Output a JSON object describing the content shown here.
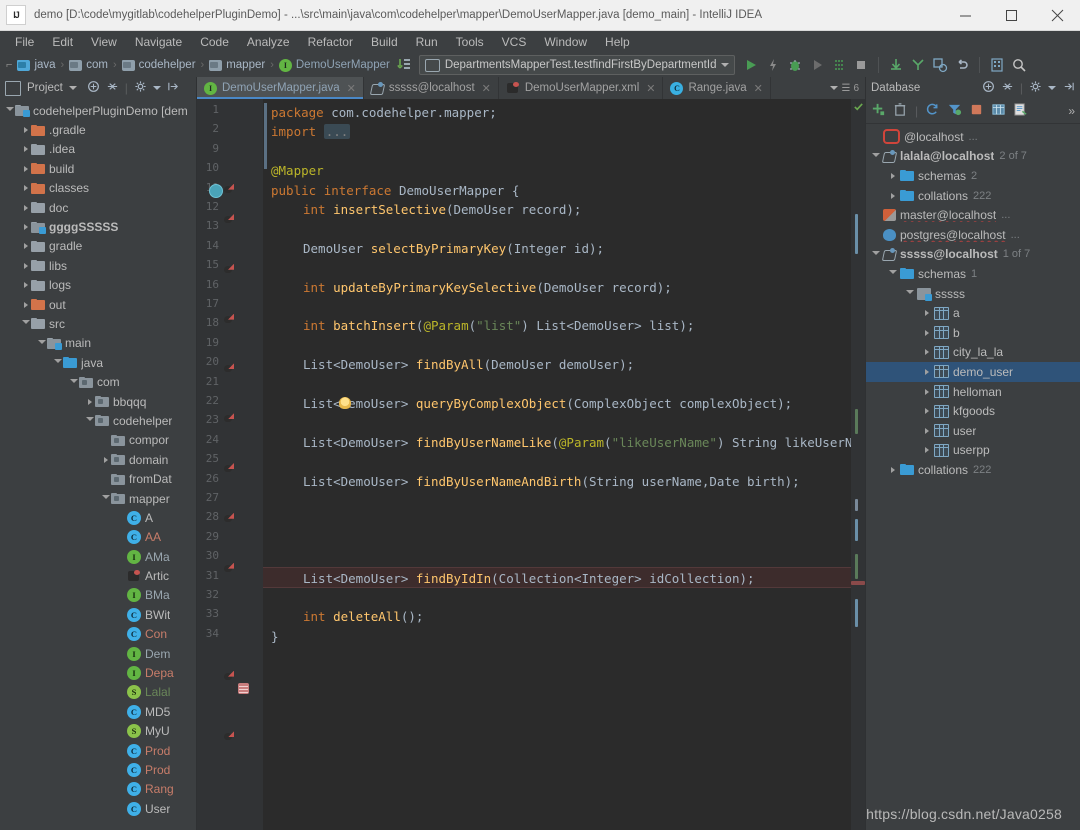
{
  "window": {
    "title": "demo [D:\\code\\mygitlab\\codehelperPluginDemo] - ...\\src\\main\\java\\com\\codehelper\\mapper\\DemoUserMapper.java [demo_main] - IntelliJ IDEA",
    "logo": "IJ",
    "minimize": "minimize-icon",
    "maximize": "maximize-icon",
    "close": "close-icon"
  },
  "menubar": {
    "items": [
      "File",
      "Edit",
      "View",
      "Navigate",
      "Code",
      "Analyze",
      "Refactor",
      "Build",
      "Run",
      "Tools",
      "VCS",
      "Window",
      "Help"
    ]
  },
  "navbar": {
    "crumbs": [
      {
        "label": "java",
        "icon": "source-folder-icon"
      },
      {
        "label": "com",
        "icon": "package-folder-icon"
      },
      {
        "label": "codehelper",
        "icon": "package-folder-icon"
      },
      {
        "label": "mapper",
        "icon": "package-folder-icon"
      },
      {
        "label": "DemoUserMapper",
        "icon": "interface-icon"
      }
    ],
    "run_config": "DepartmentsMapperTest.testfindFirstByDepartmentId",
    "toolbar_icons": [
      "run-icon",
      "run-with-coverage-icon",
      "debug-icon",
      "profile-icon",
      "run-dirty-icon",
      "stop-icon",
      "update-project-icon",
      "commit-icon",
      "branch-icon",
      "undo-icon",
      "settings-icon",
      "search-everywhere-icon"
    ]
  },
  "project_panel": {
    "title": "Project",
    "head_icons": [
      "collapse-scope-icon",
      "expand-collapse-icon",
      "gear-icon",
      "hide-icon"
    ],
    "tree": [
      {
        "depth": 0,
        "label": "codehelperPluginDemo [dem",
        "arrow": "open",
        "icon": "module-folder",
        "style": "white"
      },
      {
        "depth": 1,
        "label": ".gradle",
        "arrow": "closed",
        "icon": "folder-orange",
        "style": "white"
      },
      {
        "depth": 1,
        "label": ".idea",
        "arrow": "closed",
        "icon": "folder",
        "style": "white"
      },
      {
        "depth": 1,
        "label": "build",
        "arrow": "closed",
        "icon": "folder-orange",
        "style": "white"
      },
      {
        "depth": 1,
        "label": "classes",
        "arrow": "closed",
        "icon": "folder-orange",
        "style": "white"
      },
      {
        "depth": 1,
        "label": "doc",
        "arrow": "closed",
        "icon": "folder",
        "style": "white"
      },
      {
        "depth": 1,
        "label": "ggggSSSSS",
        "arrow": "closed",
        "icon": "module-folder",
        "style": "bold"
      },
      {
        "depth": 1,
        "label": "gradle",
        "arrow": "closed",
        "icon": "folder",
        "style": "white"
      },
      {
        "depth": 1,
        "label": "libs",
        "arrow": "closed",
        "icon": "folder",
        "style": "white"
      },
      {
        "depth": 1,
        "label": "logs",
        "arrow": "closed",
        "icon": "folder",
        "style": "white"
      },
      {
        "depth": 1,
        "label": "out",
        "arrow": "closed",
        "icon": "folder-orange",
        "style": "white"
      },
      {
        "depth": 1,
        "label": "src",
        "arrow": "open",
        "icon": "folder",
        "style": "white"
      },
      {
        "depth": 2,
        "label": "main",
        "arrow": "open",
        "icon": "module-folder",
        "style": "white"
      },
      {
        "depth": 3,
        "label": "java",
        "arrow": "open",
        "icon": "source-folder",
        "style": "white"
      },
      {
        "depth": 4,
        "label": "com",
        "arrow": "open",
        "icon": "package-folder",
        "style": "white"
      },
      {
        "depth": 5,
        "label": "bbqqq",
        "arrow": "closed",
        "icon": "package-folder",
        "style": "white"
      },
      {
        "depth": 5,
        "label": "codehelper",
        "arrow": "open",
        "icon": "package-folder",
        "style": "white"
      },
      {
        "depth": 6,
        "label": "compor",
        "arrow": "none",
        "icon": "package-folder",
        "style": "white"
      },
      {
        "depth": 6,
        "label": "domain",
        "arrow": "closed",
        "icon": "package-folder",
        "style": "white"
      },
      {
        "depth": 6,
        "label": "fromDat",
        "arrow": "none",
        "icon": "package-folder",
        "style": "white"
      },
      {
        "depth": 6,
        "label": "mapper",
        "arrow": "open",
        "icon": "package-folder",
        "style": "white"
      },
      {
        "depth": 7,
        "label": "A",
        "arrow": "none",
        "icon": "class-file",
        "style": "white"
      },
      {
        "depth": 7,
        "label": "AA",
        "arrow": "none",
        "icon": "class-file",
        "style": "red"
      },
      {
        "depth": 7,
        "label": "AMa",
        "arrow": "none",
        "icon": "interface-file",
        "style": "blue"
      },
      {
        "depth": 7,
        "label": "Artic",
        "arrow": "none",
        "icon": "xml-file",
        "style": "white"
      },
      {
        "depth": 7,
        "label": "BMa",
        "arrow": "none",
        "icon": "interface-file",
        "style": "blue"
      },
      {
        "depth": 7,
        "label": "BWit",
        "arrow": "none",
        "icon": "class-file",
        "style": "white"
      },
      {
        "depth": 7,
        "label": "Con",
        "arrow": "none",
        "icon": "class-file",
        "style": "red"
      },
      {
        "depth": 7,
        "label": "Dem",
        "arrow": "none",
        "icon": "interface-file",
        "style": "blue"
      },
      {
        "depth": 7,
        "label": "Depa",
        "arrow": "none",
        "icon": "interface-file",
        "style": "red"
      },
      {
        "depth": 7,
        "label": "Lalal",
        "arrow": "none",
        "icon": "scala-file",
        "style": "green"
      },
      {
        "depth": 7,
        "label": "MD5",
        "arrow": "none",
        "icon": "class-file",
        "style": "white"
      },
      {
        "depth": 7,
        "label": "MyU",
        "arrow": "none",
        "icon": "scala-file",
        "style": "white"
      },
      {
        "depth": 7,
        "label": "Prod",
        "arrow": "none",
        "icon": "class-file",
        "style": "red"
      },
      {
        "depth": 7,
        "label": "Prod",
        "arrow": "none",
        "icon": "class-file",
        "style": "red"
      },
      {
        "depth": 7,
        "label": "Rang",
        "arrow": "none",
        "icon": "class-file",
        "style": "red"
      },
      {
        "depth": 7,
        "label": "User",
        "arrow": "none",
        "icon": "class-file",
        "style": "white"
      }
    ]
  },
  "editor": {
    "tabs": [
      {
        "label": "DemoUserMapper.java",
        "icon": "interface-icon",
        "active": true,
        "closable": true
      },
      {
        "label": "sssss@localhost",
        "icon": "database-icon",
        "active": false,
        "closable": true
      },
      {
        "label": "DemoUserMapper.xml",
        "icon": "xml-icon",
        "active": false,
        "closable": true
      },
      {
        "label": "Range.java",
        "icon": "class-icon",
        "active": false,
        "closable": true
      }
    ],
    "tab_overflow": "6",
    "line_numbers": [
      "1",
      "2",
      "9",
      "10",
      "11",
      "12",
      "13",
      "14",
      "15",
      "16",
      "17",
      "18",
      "19",
      "20",
      "21",
      "22",
      "23",
      "24",
      "25",
      "26",
      "27",
      "28",
      "29",
      "30",
      "31",
      "32",
      "33",
      "34"
    ],
    "code": [
      {
        "line": 1,
        "indent": 0,
        "tokens": [
          {
            "t": "package ",
            "c": "kw"
          },
          {
            "t": "com.codehelper.mapper;",
            "c": "plain"
          }
        ]
      },
      {
        "line": 2,
        "indent": 0,
        "tokens": [
          {
            "t": "import ",
            "c": "kw"
          },
          {
            "t": "...",
            "c": "fold"
          }
        ]
      },
      {
        "line": 9,
        "indent": 0,
        "tokens": []
      },
      {
        "line": 10,
        "indent": 0,
        "tokens": [
          {
            "t": "@Mapper",
            "c": "ann"
          }
        ]
      },
      {
        "line": 11,
        "indent": 0,
        "tokens": [
          {
            "t": "public ",
            "c": "kw"
          },
          {
            "t": "interface ",
            "c": "kw"
          },
          {
            "t": "DemoUserMapper ",
            "c": "plain"
          },
          {
            "t": "{",
            "c": "plain"
          }
        ]
      },
      {
        "line": 12,
        "indent": 1,
        "tokens": [
          {
            "t": "int ",
            "c": "kw"
          },
          {
            "t": "insertSelective",
            "c": "fn"
          },
          {
            "t": "(DemoUser record);",
            "c": "plain"
          }
        ]
      },
      {
        "line": 13,
        "indent": 0,
        "tokens": []
      },
      {
        "line": 14,
        "indent": 1,
        "tokens": [
          {
            "t": "DemoUser ",
            "c": "plain"
          },
          {
            "t": "selectByPrimaryKey",
            "c": "fn"
          },
          {
            "t": "(Integer id);",
            "c": "plain"
          }
        ]
      },
      {
        "line": 15,
        "indent": 0,
        "tokens": []
      },
      {
        "line": 16,
        "indent": 1,
        "tokens": [
          {
            "t": "int ",
            "c": "kw"
          },
          {
            "t": "updateByPrimaryKeySelective",
            "c": "fn"
          },
          {
            "t": "(DemoUser record);",
            "c": "plain"
          }
        ]
      },
      {
        "line": 17,
        "indent": 0,
        "tokens": []
      },
      {
        "line": 18,
        "indent": 1,
        "tokens": [
          {
            "t": "int ",
            "c": "kw"
          },
          {
            "t": "batchInsert",
            "c": "fn"
          },
          {
            "t": "(",
            "c": "plain"
          },
          {
            "t": "@Param",
            "c": "ann"
          },
          {
            "t": "(",
            "c": "plain"
          },
          {
            "t": "\"list\"",
            "c": "str"
          },
          {
            "t": ") List<DemoUser> list);",
            "c": "plain"
          }
        ]
      },
      {
        "line": 19,
        "indent": 0,
        "tokens": []
      },
      {
        "line": 20,
        "indent": 1,
        "tokens": [
          {
            "t": "List<DemoUser> ",
            "c": "plain"
          },
          {
            "t": "findByAll",
            "c": "fn"
          },
          {
            "t": "(DemoUser demoUser);",
            "c": "plain"
          }
        ]
      },
      {
        "line": 21,
        "indent": 0,
        "tokens": []
      },
      {
        "line": 22,
        "indent": 1,
        "tokens": [
          {
            "t": "List<DemoUser> ",
            "c": "plain"
          },
          {
            "t": "queryByComplexObject",
            "c": "fn"
          },
          {
            "t": "(ComplexObject complexObject);",
            "c": "plain"
          }
        ]
      },
      {
        "line": 23,
        "indent": 0,
        "tokens": []
      },
      {
        "line": 24,
        "indent": 1,
        "tokens": [
          {
            "t": "List<DemoUser> ",
            "c": "plain"
          },
          {
            "t": "findByUserNameLike",
            "c": "fn"
          },
          {
            "t": "(",
            "c": "plain"
          },
          {
            "t": "@Param",
            "c": "ann"
          },
          {
            "t": "(",
            "c": "plain"
          },
          {
            "t": "\"likeUserName\"",
            "c": "str"
          },
          {
            "t": ") String likeUserN",
            "c": "plain"
          }
        ]
      },
      {
        "line": 25,
        "indent": 0,
        "tokens": []
      },
      {
        "line": 26,
        "indent": 1,
        "tokens": [
          {
            "t": "List<DemoUser> ",
            "c": "plain"
          },
          {
            "t": "findByUserNameAndBirth",
            "c": "fn"
          },
          {
            "t": "(String userName,Date birth);",
            "c": "plain"
          }
        ]
      },
      {
        "line": 27,
        "indent": 0,
        "tokens": []
      },
      {
        "line": 28,
        "indent": 0,
        "tokens": []
      },
      {
        "line": 29,
        "indent": 0,
        "tokens": []
      },
      {
        "line": 30,
        "indent": 0,
        "tokens": []
      },
      {
        "line": 31,
        "indent": 1,
        "tokens": [
          {
            "t": "List<DemoUser> ",
            "c": "plain"
          },
          {
            "t": "findByIdIn",
            "c": "fn"
          },
          {
            "t": "(Collection<Integer> idCollection);",
            "c": "plain"
          }
        ]
      },
      {
        "line": 32,
        "indent": 0,
        "tokens": []
      },
      {
        "line": 33,
        "indent": 1,
        "tokens": [
          {
            "t": "int ",
            "c": "kw"
          },
          {
            "t": "deleteAll",
            "c": "fn"
          },
          {
            "t": "();",
            "c": "plain"
          }
        ]
      },
      {
        "line": 34,
        "indent": 0,
        "tokens": [
          {
            "t": "}",
            "c": "plain"
          }
        ]
      }
    ],
    "highlighted_line": 31
  },
  "database_panel": {
    "title": "Database",
    "head_icons": [
      "collapse-icon",
      "expand-collapse-icon",
      "gear-icon",
      "hide-icon"
    ],
    "toolbar_icons": [
      "add-icon",
      "remove-icon",
      "refresh-icon",
      "filter-icon",
      "stop-icon",
      "table-icon",
      "console-icon",
      "more-icon"
    ],
    "tree": [
      {
        "depth": 0,
        "label": "@localhost",
        "suffix": "...",
        "arrow": "none",
        "icon": "db-disconnected",
        "style": "white"
      },
      {
        "depth": 0,
        "label": "lalala@localhost",
        "suffix": "2 of 7",
        "arrow": "open",
        "icon": "db-connection",
        "style": "bold"
      },
      {
        "depth": 1,
        "label": "schemas",
        "suffix": "2",
        "arrow": "closed",
        "icon": "folder-blue",
        "style": "white"
      },
      {
        "depth": 1,
        "label": "collations",
        "suffix": "222",
        "arrow": "closed",
        "icon": "folder-blue",
        "style": "white"
      },
      {
        "depth": 0,
        "label": "master@localhost",
        "suffix": "...",
        "arrow": "none",
        "icon": "db-mssql",
        "style": "white"
      },
      {
        "depth": 0,
        "label": "postgres@localhost",
        "suffix": "...",
        "arrow": "none",
        "icon": "db-postgres",
        "style": "white"
      },
      {
        "depth": 0,
        "label": "sssss@localhost",
        "suffix": "1 of 7",
        "arrow": "open",
        "icon": "db-connection",
        "style": "bold"
      },
      {
        "depth": 1,
        "label": "schemas",
        "suffix": "1",
        "arrow": "open",
        "icon": "folder-blue",
        "style": "white"
      },
      {
        "depth": 2,
        "label": "sssss",
        "suffix": "",
        "arrow": "open",
        "icon": "schema",
        "style": "white"
      },
      {
        "depth": 3,
        "label": "a",
        "suffix": "",
        "arrow": "closed",
        "icon": "table",
        "style": "white"
      },
      {
        "depth": 3,
        "label": "b",
        "suffix": "",
        "arrow": "closed",
        "icon": "table",
        "style": "white"
      },
      {
        "depth": 3,
        "label": "city_la_la",
        "suffix": "",
        "arrow": "closed",
        "icon": "table",
        "style": "white"
      },
      {
        "depth": 3,
        "label": "demo_user",
        "suffix": "",
        "arrow": "closed",
        "icon": "table",
        "style": "white",
        "selected": true
      },
      {
        "depth": 3,
        "label": "helloman",
        "suffix": "",
        "arrow": "closed",
        "icon": "table",
        "style": "white"
      },
      {
        "depth": 3,
        "label": "kfgoods",
        "suffix": "",
        "arrow": "closed",
        "icon": "table",
        "style": "white"
      },
      {
        "depth": 3,
        "label": "user",
        "suffix": "",
        "arrow": "closed",
        "icon": "table",
        "style": "white"
      },
      {
        "depth": 3,
        "label": "userpp",
        "suffix": "",
        "arrow": "closed",
        "icon": "table",
        "style": "white"
      },
      {
        "depth": 1,
        "label": "collations",
        "suffix": "222",
        "arrow": "closed",
        "icon": "folder-blue",
        "style": "white"
      }
    ]
  },
  "watermark": "https://blog.csdn.net/Java0258",
  "colors": {
    "editor_bg": "#2b2b2b",
    "panel_bg": "#3c3f41",
    "gutter_bg": "#313335",
    "selection_blue": "#2f5379",
    "keyword_orange": "#cc7832",
    "string_green": "#6a8759",
    "method_yellow": "#ffc66d",
    "annotation_yellow": "#bbb529",
    "default_text": "#a9b7c6",
    "error_line": "#3d2c2c",
    "accent_tab": "#4a88c7"
  }
}
